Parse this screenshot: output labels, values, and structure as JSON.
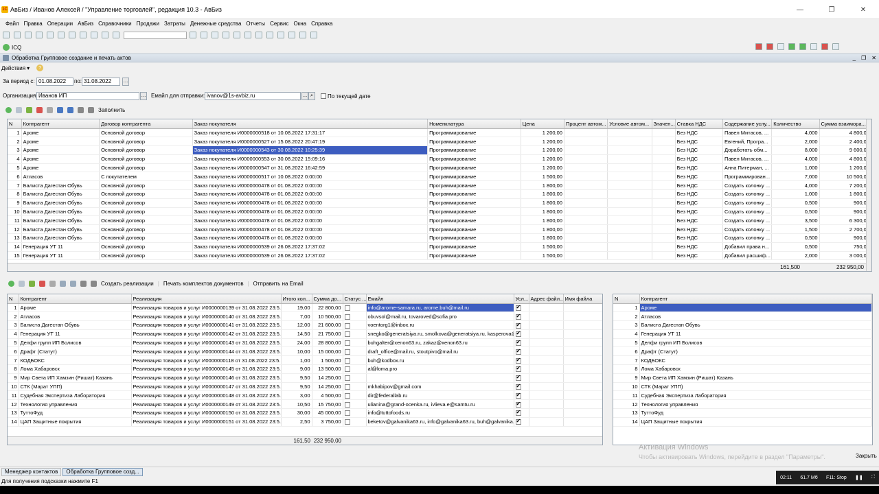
{
  "window": {
    "title": "АвБиз / Иванов Алексей / \"Управление торговлей\", редакция 10.3 - АвБиз",
    "icon_label": "1С"
  },
  "menu": [
    "Файл",
    "Правка",
    "Операции",
    "АвБиз",
    "Справочники",
    "Продажи",
    "Затраты",
    "Денежные средства",
    "Отчеты",
    "Сервис",
    "Окна",
    "Справка"
  ],
  "icq_label": "ICQ",
  "form": {
    "title": "Обработка  Групповое создание и печать актов",
    "actions_label": "Действия",
    "period_from_label": "За период с:",
    "period_from": "01.08.2022",
    "period_to_label": "по:",
    "period_to": "31.08.2022",
    "org_label": "Организация:",
    "org_value": "Иванов ИП",
    "email_label": "Емайл для отправки:",
    "email_value": "ivanov@1s-avbiz.ru",
    "current_date_label": "По текущей дате",
    "fill_label": "Заполнить",
    "close_label": "Закрыть"
  },
  "top_grid": {
    "columns": [
      "N",
      "Контрагент",
      "Договор контрагента",
      "Заказ покупателя",
      "Номенклатура",
      "Цена",
      "Процент автом...",
      "Условие автом...",
      "Значен...",
      "Ставка НДС",
      "Содержание услу...",
      "Количество",
      "Сумма взаимора..."
    ],
    "rows": [
      [
        "1",
        "Ароме",
        "Основной договор",
        "Заказ покупателя И0000000518 от 10.08.2022 17:31:17",
        "Программирование",
        "1 200,00",
        "",
        "",
        "",
        "Без НДС",
        "Павел Митасов, ...",
        "4,000",
        "4 800,00"
      ],
      [
        "2",
        "Ароме",
        "Основной договор",
        "Заказ покупателя И0000000527 от 15.08.2022 20:47:19",
        "Программирование",
        "1 200,00",
        "",
        "",
        "",
        "Без НДС",
        "Евгений, Програ...",
        "2,000",
        "2 400,00"
      ],
      [
        "3",
        "Ароме",
        "Основной договор",
        "Заказ покупателя И0000000543 от 30.08.2022 10:25:39",
        "Программирование",
        "1 200,00",
        "",
        "",
        "",
        "Без НДС",
        "Доработать обм...",
        "8,000",
        "9 600,00"
      ],
      [
        "4",
        "Ароме",
        "Основной договор",
        "Заказ покупателя И0000000553 от 30.08.2022 15:09:16",
        "Программирование",
        "1 200,00",
        "",
        "",
        "",
        "Без НДС",
        "Павел Митасов, ...",
        "4,000",
        "4 800,00"
      ],
      [
        "5",
        "Ароме",
        "Основной договор",
        "Заказ покупателя И0000000547 от 31.08.2022 16:42:59",
        "Программирование",
        "1 200,00",
        "",
        "",
        "",
        "Без НДС",
        "Анна Питерман, ...",
        "1,000",
        "1 200,00"
      ],
      [
        "6",
        "Атласов",
        "С покупателем",
        "Заказ покупателя И0000000517 от 10.08.2022 0:00:00",
        "Программирование",
        "1 500,00",
        "",
        "",
        "",
        "Без НДС",
        "Программирован...",
        "7,000",
        "10 500,00"
      ],
      [
        "7",
        "Балиста Дагестан Обувь",
        "Основной договор",
        "Заказ покупателя И0000000478 от 01.08.2022 0:00:00",
        "Программирование",
        "1 800,00",
        "",
        "",
        "",
        "Без НДС",
        "Создать колонку ...",
        "4,000",
        "7 200,00"
      ],
      [
        "8",
        "Балиста Дагестан Обувь",
        "Основной договор",
        "Заказ покупателя И0000000478 от 01.08.2022 0:00:00",
        "Программирование",
        "1 800,00",
        "",
        "",
        "",
        "Без НДС",
        "Создать колонку ...",
        "1,000",
        "1 800,00"
      ],
      [
        "9",
        "Балиста Дагестан Обувь",
        "Основной договор",
        "Заказ покупателя И0000000478 от 01.08.2022 0:00:00",
        "Программирование",
        "1 800,00",
        "",
        "",
        "",
        "Без НДС",
        "Создать колонку ...",
        "0,500",
        "900,00"
      ],
      [
        "10",
        "Балиста Дагестан Обувь",
        "Основной договор",
        "Заказ покупателя И0000000478 от 01.08.2022 0:00:00",
        "Программирование",
        "1 800,00",
        "",
        "",
        "",
        "Без НДС",
        "Создать колонку ...",
        "0,500",
        "900,00"
      ],
      [
        "11",
        "Балиста Дагестан Обувь",
        "Основной договор",
        "Заказ покупателя И0000000478 от 01.08.2022 0:00:00",
        "Программирование",
        "1 800,00",
        "",
        "",
        "",
        "Без НДС",
        "Создать колонку ...",
        "3,500",
        "6 300,00"
      ],
      [
        "12",
        "Балиста Дагестан Обувь",
        "Основной договор",
        "Заказ покупателя И0000000478 от 01.08.2022 0:00:00",
        "Программирование",
        "1 800,00",
        "",
        "",
        "",
        "Без НДС",
        "Создать колонку ...",
        "1,500",
        "2 700,00"
      ],
      [
        "13",
        "Балиста Дагестан Обувь",
        "Основной договор",
        "Заказ покупателя И0000000478 от 01.08.2022 0:00:00",
        "Программирование",
        "1 800,00",
        "",
        "",
        "",
        "Без НДС",
        "Создать колонку ...",
        "0,500",
        "900,00"
      ],
      [
        "14",
        "Генерация УТ 11",
        "Основной договор",
        "Заказ покупателя И0000000539 от 26.08.2022 17:37:02",
        "Программирование",
        "1 500,00",
        "",
        "",
        "",
        "Без НДС",
        "Добавил права н...",
        "0,500",
        "750,00"
      ],
      [
        "15",
        "Генерация УТ 11",
        "Основной договор",
        "Заказ покупателя И0000000539 от 26.08.2022 17:37:02",
        "Программирование",
        "1 500,00",
        "",
        "",
        "",
        "Без НДС",
        "Добавил расшиф...",
        "2,000",
        "3 000,00"
      ]
    ],
    "selected_row": 2,
    "selected_col": 3,
    "total_qty": "161,500",
    "total_sum": "232 950,00"
  },
  "bottom_toolbar": {
    "create_label": "Создать реализации",
    "print_label": "Печать комплектов документов",
    "send_label": "Отправить на Email"
  },
  "bottom_grid": {
    "columns": [
      "N",
      "Контрагент",
      "Реализация",
      "Итого кол...",
      "Сумма до...",
      "Статус ...",
      "Емайл",
      "Усл...",
      "Адрес файл...",
      "Имя файла"
    ],
    "rows": [
      [
        "1",
        "Ароме",
        "Реализация товаров и услуг И0000000139 от 31.08.2022 23:5...",
        "19,00",
        "22 800,00",
        false,
        "info@arome-samara.ru, arome.buh@mail.ru",
        true
      ],
      [
        "2",
        "Атласов",
        "Реализация товаров и услуг И0000000140 от 31.08.2022 23:5...",
        "7,00",
        "10 500,00",
        false,
        "obuvsol@mail.ru, tovaroved@sofia.pro",
        true
      ],
      [
        "3",
        "Балиста Дагестан Обувь",
        "Реализация товаров и услуг И0000000141 от 31.08.2022 23:5...",
        "12,00",
        "21 600,00",
        false,
        "voentorg1@inbox.ru",
        true
      ],
      [
        "4",
        "Генерация УТ 11",
        "Реализация товаров и услуг И0000000142 от 31.08.2022 23:5...",
        "14,50",
        "21 750,00",
        false,
        "snegko@generatsiya.ru, smolkova@generatsiya.ru, kasperova@...",
        true
      ],
      [
        "5",
        "Делфи групп ИП Болисов",
        "Реализация товаров и услуг И0000000143 от 31.08.2022 23:5...",
        "24,00",
        "28 800,00",
        false,
        "buhgalter@xenon63.ru, zakaz@xenon63.ru",
        true
      ],
      [
        "6",
        "Драфт (Статут)",
        "Реализация товаров и услуг И0000000144 от 31.08.2022 23:5...",
        "10,00",
        "15 000,00",
        false,
        "draft_office@mail.ru, stoutpivo@mail.ru",
        true
      ],
      [
        "7",
        "КОДБОКС",
        "Реализация товаров и услуг И0000000118 от 31.08.2022 23:5...",
        "1,00",
        "1 500,00",
        false,
        "buh@kodbox.ru",
        true
      ],
      [
        "8",
        "Лома Хабаровск",
        "Реализация товаров и услуг И0000000145 от 31.08.2022 23:5...",
        "9,00",
        "13 500,00",
        false,
        "al@loma.pro",
        true
      ],
      [
        "9",
        "Мир Света ИП Хамзин (Ришат) Казань",
        "Реализация товаров и услуг И0000000146 от 31.08.2022 23:5...",
        "9,50",
        "14 250,00",
        false,
        "",
        true
      ],
      [
        "10",
        "СТК (Марат УПП)",
        "Реализация товаров и услуг И0000000147 от 31.08.2022 23:5...",
        "9,50",
        "14 250,00",
        false,
        "mkhabipov@gmail.com",
        true
      ],
      [
        "11",
        "Судебная Экспертиза Лаборатория",
        "Реализация товаров и услуг И0000000148 от 31.08.2022 23:5...",
        "3,00",
        "4 500,00",
        false,
        "dir@federallab.ru",
        true
      ],
      [
        "12",
        "Технология управления",
        "Реализация товаров и услуг И0000000149 от 31.08.2022 23:5...",
        "10,50",
        "15 750,00",
        false,
        "ulianina@grand-ocenka.ru, ivlieva.e@samtu.ru",
        true
      ],
      [
        "13",
        "ТуттоФуд",
        "Реализация товаров и услуг И0000000150 от 31.08.2022 23:5...",
        "30,00",
        "45 000,00",
        false,
        "info@tuttofoods.ru",
        true
      ],
      [
        "14",
        "ЦАП Защитные покрытия",
        "Реализация товаров и услуг И0000000151 от 31.08.2022 23:5...",
        "2,50",
        "3 750,00",
        false,
        "beketov@galvanika63.ru, info@galvanika63.ru, buh@galvanika...",
        true
      ]
    ],
    "total_qty": "161,50",
    "total_sum": "232 950,00"
  },
  "right_grid": {
    "columns": [
      "N",
      "Контрагент"
    ],
    "rows": [
      [
        "1",
        "Ароме"
      ],
      [
        "2",
        "Атласов"
      ],
      [
        "3",
        "Балиста Дагестан Обувь"
      ],
      [
        "4",
        "Генерация УТ 11"
      ],
      [
        "5",
        "Делфи групп ИП Болисов"
      ],
      [
        "6",
        "Драфт (Статут)"
      ],
      [
        "7",
        "КОДБОКС"
      ],
      [
        "8",
        "Лома Хабаровск"
      ],
      [
        "9",
        "Мир Света ИП Хамзин (Ришат) Казань"
      ],
      [
        "10",
        "СТК (Марат УПП)"
      ],
      [
        "11",
        "Судебная Экспертиза Лаборатория"
      ],
      [
        "12",
        "Технология управления"
      ],
      [
        "13",
        "ТуттоФуд"
      ],
      [
        "14",
        "ЦАП Защитные покрытия"
      ]
    ]
  },
  "watermark": {
    "line1": "Активация Windows",
    "line2": "Чтобы активировать Windows, перейдите в раздел \"Параметры\"."
  },
  "taskbar": {
    "items": [
      "Менеджер контактов",
      "Обработка  Групповое созд..."
    ]
  },
  "status_text": "Для получения подсказки нажмите F1",
  "system": {
    "time": "02:11",
    "memory": "61.7 Мб",
    "hotkey": "F11: Stop"
  }
}
